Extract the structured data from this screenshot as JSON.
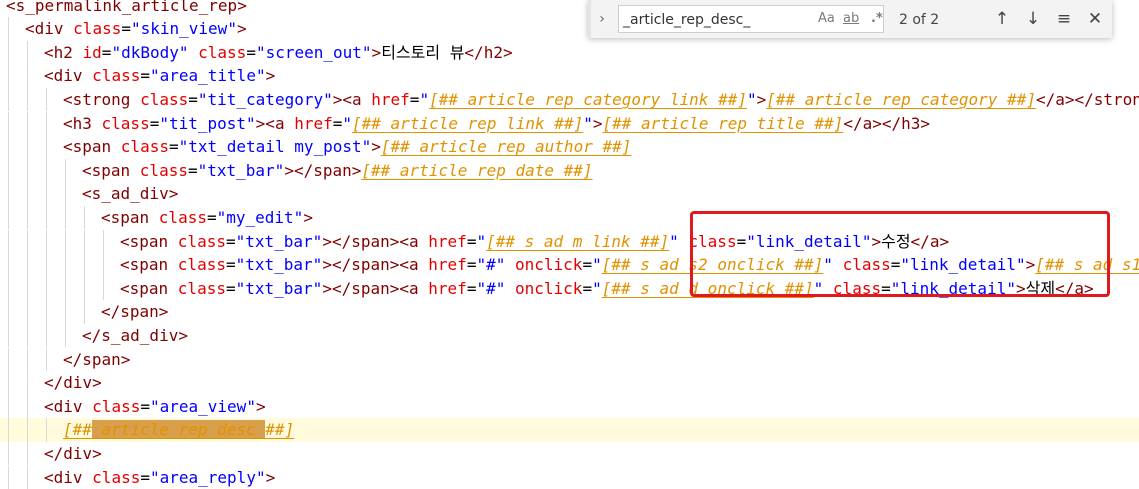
{
  "find_widget": {
    "query": "_article_rep_desc_",
    "match_count": "2 of 2",
    "toggle_icon": "chevron-right-icon",
    "option_case": "Aa",
    "option_word": "ab",
    "option_regex": ".*",
    "prev_icon": "arrow-up-icon",
    "next_icon": "arrow-down-icon",
    "selection_icon": "find-in-selection-icon",
    "close_icon": "close-icon"
  },
  "colors": {
    "tag": "#800000",
    "attribute": "#e50000",
    "string": "#0000ff",
    "placeholder": "#e09200",
    "highlight_box": "#e0181f",
    "current_line": "#fffbdc"
  },
  "lines": [
    {
      "indent": 0,
      "tokens": [
        {
          "t": "tag",
          "v": "<s_permalink_article_rep>"
        }
      ]
    },
    {
      "indent": 1,
      "tokens": [
        {
          "t": "tag",
          "v": "<div "
        },
        {
          "t": "attr",
          "v": "class"
        },
        {
          "t": "text",
          "v": "="
        },
        {
          "t": "str",
          "v": "\"skin_view\""
        },
        {
          "t": "tag",
          "v": ">"
        }
      ]
    },
    {
      "indent": 2,
      "tokens": [
        {
          "t": "tag",
          "v": "<h2 "
        },
        {
          "t": "attr",
          "v": "id"
        },
        {
          "t": "text",
          "v": "="
        },
        {
          "t": "str",
          "v": "\"dkBody\""
        },
        {
          "t": "text",
          "v": " "
        },
        {
          "t": "attr",
          "v": "class"
        },
        {
          "t": "text",
          "v": "="
        },
        {
          "t": "str",
          "v": "\"screen_out\""
        },
        {
          "t": "tag",
          "v": ">"
        },
        {
          "t": "text",
          "v": "티스토리 뷰"
        },
        {
          "t": "tag",
          "v": "</h2>"
        }
      ]
    },
    {
      "indent": 2,
      "tokens": [
        {
          "t": "tag",
          "v": "<div "
        },
        {
          "t": "attr",
          "v": "class"
        },
        {
          "t": "text",
          "v": "="
        },
        {
          "t": "str",
          "v": "\"area_title\""
        },
        {
          "t": "tag",
          "v": ">"
        }
      ]
    },
    {
      "indent": 3,
      "tokens": [
        {
          "t": "tag",
          "v": "<strong "
        },
        {
          "t": "attr",
          "v": "class"
        },
        {
          "t": "text",
          "v": "="
        },
        {
          "t": "str",
          "v": "\"tit_category\""
        },
        {
          "t": "tag",
          "v": "><a "
        },
        {
          "t": "attr",
          "v": "href"
        },
        {
          "t": "text",
          "v": "="
        },
        {
          "t": "str",
          "v": "\""
        },
        {
          "t": "ph",
          "v": "[##_article_rep_category_link_##]"
        },
        {
          "t": "str",
          "v": "\""
        },
        {
          "t": "tag",
          "v": ">"
        },
        {
          "t": "ph",
          "v": "[##_article_rep_category_##]"
        },
        {
          "t": "tag",
          "v": "</a></strong>"
        }
      ]
    },
    {
      "indent": 3,
      "tokens": [
        {
          "t": "tag",
          "v": "<h3 "
        },
        {
          "t": "attr",
          "v": "class"
        },
        {
          "t": "text",
          "v": "="
        },
        {
          "t": "str",
          "v": "\"tit_post\""
        },
        {
          "t": "tag",
          "v": "><a "
        },
        {
          "t": "attr",
          "v": "href"
        },
        {
          "t": "text",
          "v": "="
        },
        {
          "t": "str",
          "v": "\""
        },
        {
          "t": "ph",
          "v": "[##_article_rep_link_##]"
        },
        {
          "t": "str",
          "v": "\""
        },
        {
          "t": "tag",
          "v": ">"
        },
        {
          "t": "ph",
          "v": "[##_article_rep_title_##]"
        },
        {
          "t": "tag",
          "v": "</a></h3>"
        }
      ]
    },
    {
      "indent": 3,
      "tokens": [
        {
          "t": "tag",
          "v": "<span "
        },
        {
          "t": "attr",
          "v": "class"
        },
        {
          "t": "text",
          "v": "="
        },
        {
          "t": "str",
          "v": "\"txt_detail my_post\""
        },
        {
          "t": "tag",
          "v": ">"
        },
        {
          "t": "ph",
          "v": "[##_article_rep_author_##]"
        }
      ]
    },
    {
      "indent": 4,
      "tokens": [
        {
          "t": "tag",
          "v": "<span "
        },
        {
          "t": "attr",
          "v": "class"
        },
        {
          "t": "text",
          "v": "="
        },
        {
          "t": "str",
          "v": "\"txt_bar\""
        },
        {
          "t": "tag",
          "v": "></span>"
        },
        {
          "t": "ph",
          "v": "[##_article_rep_date_##]"
        }
      ]
    },
    {
      "indent": 4,
      "tokens": [
        {
          "t": "tag",
          "v": "<s_ad_div>"
        }
      ]
    },
    {
      "indent": 5,
      "tokens": [
        {
          "t": "tag",
          "v": "<span "
        },
        {
          "t": "attr",
          "v": "class"
        },
        {
          "t": "text",
          "v": "="
        },
        {
          "t": "str",
          "v": "\"my_edit\""
        },
        {
          "t": "tag",
          "v": ">"
        }
      ]
    },
    {
      "indent": 6,
      "tokens": [
        {
          "t": "tag",
          "v": "<span "
        },
        {
          "t": "attr",
          "v": "class"
        },
        {
          "t": "text",
          "v": "="
        },
        {
          "t": "str",
          "v": "\"txt_bar\""
        },
        {
          "t": "tag",
          "v": "></span><a "
        },
        {
          "t": "attr",
          "v": "href"
        },
        {
          "t": "text",
          "v": "="
        },
        {
          "t": "str",
          "v": "\""
        },
        {
          "t": "ph",
          "v": "[##_s_ad_m_link_##]"
        },
        {
          "t": "str",
          "v": "\""
        },
        {
          "t": "text",
          "v": " "
        },
        {
          "t": "attr",
          "v": "class"
        },
        {
          "t": "text",
          "v": "="
        },
        {
          "t": "str",
          "v": "\"link_detail\""
        },
        {
          "t": "tag",
          "v": ">"
        },
        {
          "t": "text",
          "v": "수정"
        },
        {
          "t": "tag",
          "v": "</a>"
        }
      ]
    },
    {
      "indent": 6,
      "tokens": [
        {
          "t": "tag",
          "v": "<span "
        },
        {
          "t": "attr",
          "v": "class"
        },
        {
          "t": "text",
          "v": "="
        },
        {
          "t": "str",
          "v": "\"txt_bar\""
        },
        {
          "t": "tag",
          "v": "></span><a "
        },
        {
          "t": "attr",
          "v": "href"
        },
        {
          "t": "text",
          "v": "="
        },
        {
          "t": "str",
          "v": "\"#\""
        },
        {
          "t": "text",
          "v": " "
        },
        {
          "t": "attr",
          "v": "onclick"
        },
        {
          "t": "text",
          "v": "="
        },
        {
          "t": "str",
          "v": "\""
        },
        {
          "t": "ph",
          "v": "[##_s_ad_s2_onclick_##]"
        },
        {
          "t": "str",
          "v": "\""
        },
        {
          "t": "text",
          "v": " "
        },
        {
          "t": "attr",
          "v": "class"
        },
        {
          "t": "text",
          "v": "="
        },
        {
          "t": "str",
          "v": "\"link_detail\""
        },
        {
          "t": "tag",
          "v": ">"
        },
        {
          "t": "ph",
          "v": "[##_s_ad_s1"
        }
      ]
    },
    {
      "indent": 6,
      "tokens": [
        {
          "t": "tag",
          "v": "<span "
        },
        {
          "t": "attr",
          "v": "class"
        },
        {
          "t": "text",
          "v": "="
        },
        {
          "t": "str",
          "v": "\"txt_bar\""
        },
        {
          "t": "tag",
          "v": "></span><a "
        },
        {
          "t": "attr",
          "v": "href"
        },
        {
          "t": "text",
          "v": "="
        },
        {
          "t": "str",
          "v": "\"#\""
        },
        {
          "t": "text",
          "v": " "
        },
        {
          "t": "attr",
          "v": "onclick"
        },
        {
          "t": "text",
          "v": "="
        },
        {
          "t": "str",
          "v": "\""
        },
        {
          "t": "ph",
          "v": "[##_s_ad_d_onclick_##]"
        },
        {
          "t": "str",
          "v": "\""
        },
        {
          "t": "text",
          "v": " "
        },
        {
          "t": "attr",
          "v": "class"
        },
        {
          "t": "text",
          "v": "="
        },
        {
          "t": "str",
          "v": "\"link_detail\""
        },
        {
          "t": "tag",
          "v": ">"
        },
        {
          "t": "text",
          "v": "삭제"
        },
        {
          "t": "tag",
          "v": "</a>"
        }
      ]
    },
    {
      "indent": 5,
      "tokens": [
        {
          "t": "tag",
          "v": "</span>"
        }
      ]
    },
    {
      "indent": 4,
      "tokens": [
        {
          "t": "tag",
          "v": "</s_ad_div>"
        }
      ]
    },
    {
      "indent": 3,
      "tokens": [
        {
          "t": "tag",
          "v": "</span>"
        }
      ]
    },
    {
      "indent": 2,
      "tokens": [
        {
          "t": "tag",
          "v": "</div>"
        }
      ]
    },
    {
      "indent": 2,
      "tokens": [
        {
          "t": "tag",
          "v": "<div "
        },
        {
          "t": "attr",
          "v": "class"
        },
        {
          "t": "text",
          "v": "="
        },
        {
          "t": "str",
          "v": "\"area_view\""
        },
        {
          "t": "tag",
          "v": ">"
        }
      ]
    },
    {
      "indent": 3,
      "current": true,
      "tokens": [
        {
          "t": "ph",
          "v": "[##"
        },
        {
          "t": "phm",
          "v": "_article_rep_desc_"
        },
        {
          "t": "ph",
          "v": "##]"
        }
      ]
    },
    {
      "indent": 2,
      "tokens": [
        {
          "t": "tag",
          "v": "</div>"
        }
      ]
    },
    {
      "indent": 2,
      "tokens": [
        {
          "t": "tag",
          "v": "<div "
        },
        {
          "t": "attr",
          "v": "class"
        },
        {
          "t": "text",
          "v": "="
        },
        {
          "t": "str",
          "v": "\"area_reply\""
        },
        {
          "t": "tag",
          "v": ">"
        }
      ]
    }
  ]
}
